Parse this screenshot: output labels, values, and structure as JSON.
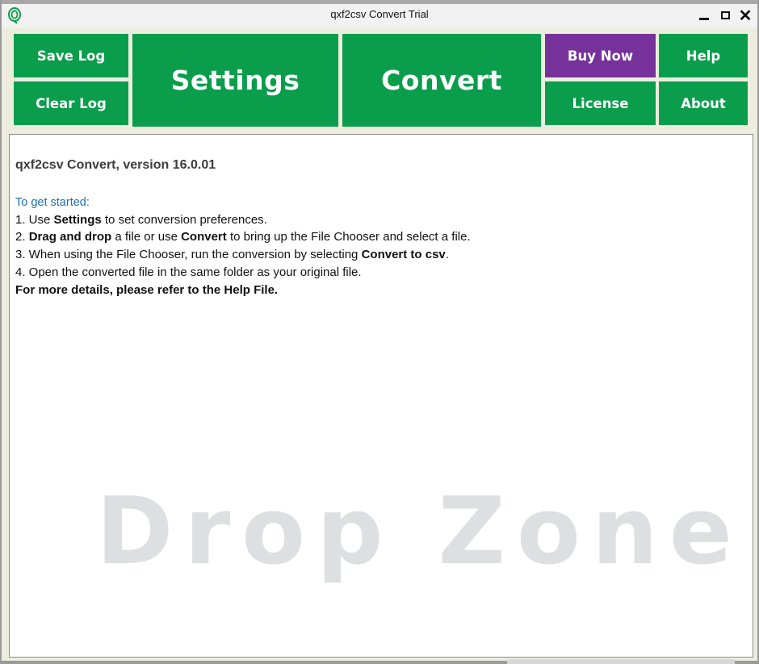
{
  "window": {
    "title": "qxf2csv Convert Trial"
  },
  "toolbar": {
    "save_log": "Save Log",
    "clear_log": "Clear Log",
    "settings": "Settings",
    "convert": "Convert",
    "buy_now": "Buy Now",
    "help": "Help",
    "license": "License",
    "about": "About",
    "colors": {
      "green": "#0a9d4b",
      "purple": "#77319b"
    }
  },
  "log": {
    "version": "qxf2csv Convert, version 16.0.01",
    "started": "To get started:",
    "line1": {
      "a": "1. Use ",
      "b": "Settings",
      "c": " to set conversion preferences."
    },
    "line2": {
      "a": "2. ",
      "b": "Drag and drop",
      "c": " a file or use ",
      "d": "Convert",
      "e": " to bring up the File Chooser and select a file."
    },
    "line3": {
      "a": "3. When using the File Chooser, run the conversion by selecting ",
      "b": "Convert to csv",
      "c": "."
    },
    "line4": "4. Open the converted file in the same folder as your original file.",
    "line5": "For more details, please refer to the Help File.",
    "dropzone": "Drop Zone"
  },
  "icons": [
    "app-logo-icon",
    "minimize-icon",
    "maximize-icon",
    "close-icon"
  ]
}
